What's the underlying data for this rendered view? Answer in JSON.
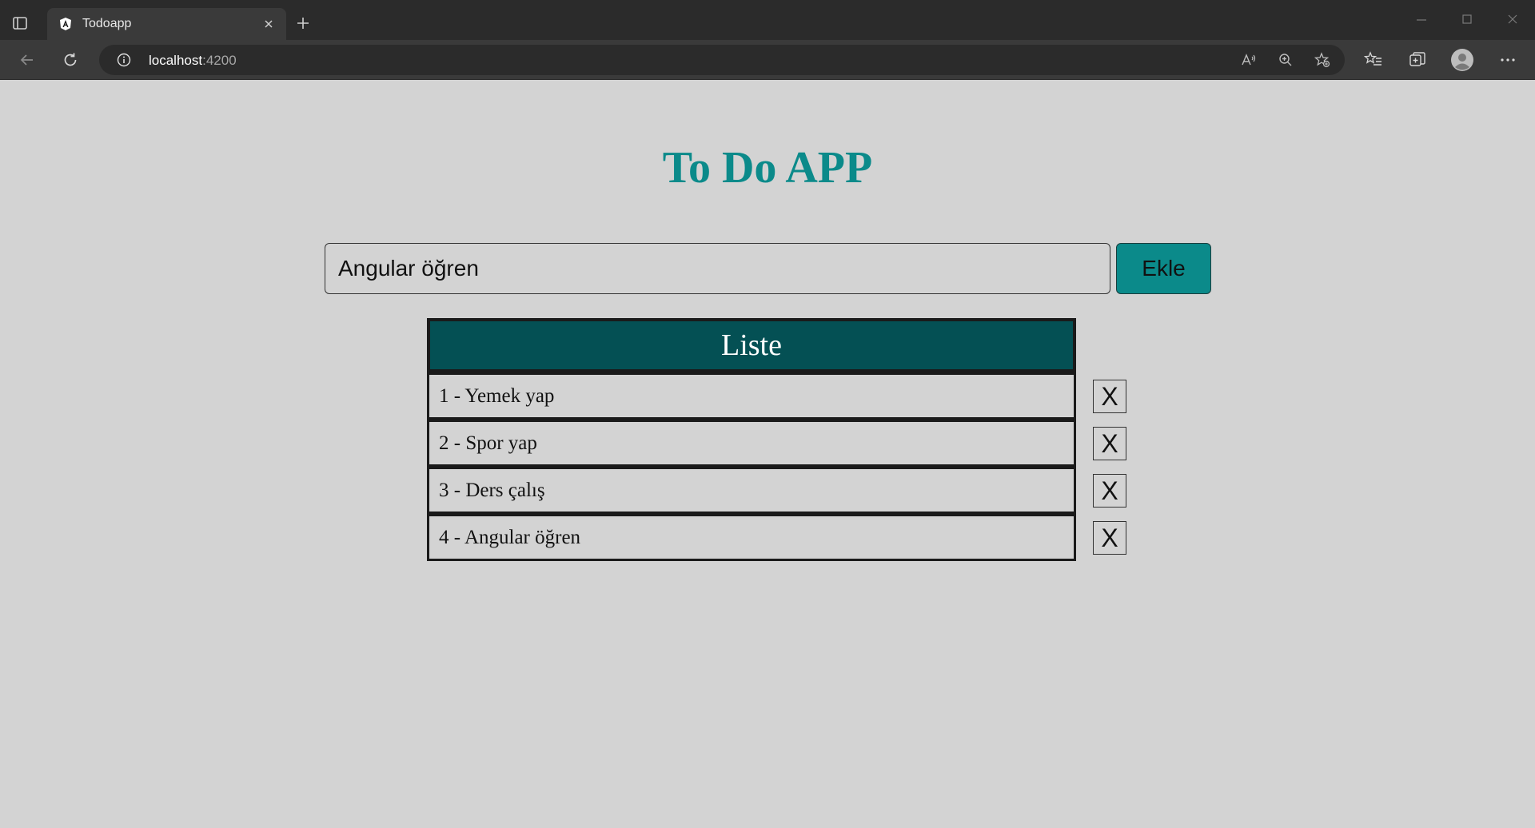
{
  "browser": {
    "tab_title": "Todoapp",
    "url_host": "localhost",
    "url_port": ":4200"
  },
  "app": {
    "title": "To Do APP",
    "input_value": "Angular öğren",
    "add_label": "Ekle",
    "table_header": "Liste",
    "delete_label": "X",
    "items": [
      "1 - Yemek yap",
      "2 - Spor yap",
      "3 - Ders çalış",
      "4 - Angular öğren"
    ]
  },
  "colors": {
    "accent": "#0b8a8a",
    "header_bg": "#045054",
    "page_bg": "#d3d3d3"
  }
}
